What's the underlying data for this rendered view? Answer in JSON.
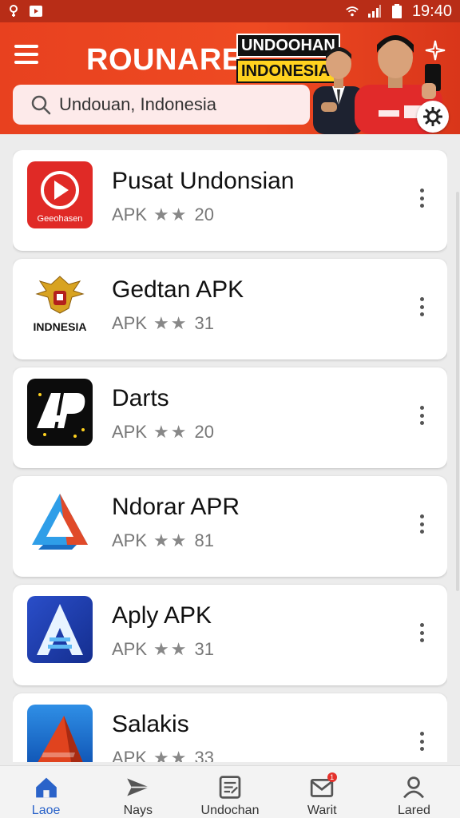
{
  "status_bar": {
    "time": "19:40",
    "icons": [
      "notification-icon",
      "youtube-icon",
      "wifi-icon",
      "signal-icon",
      "battery-icon"
    ]
  },
  "header": {
    "brand": "ROUNARE",
    "promo_line1": "UNDOOHAN",
    "promo_line2": "INDONESIA!",
    "search_text": "Undouan, Indonesia",
    "colors": {
      "primary": "#e8411f",
      "status_bar": "#b82d17",
      "promo_yellow": "#ffd21f"
    }
  },
  "apps": [
    {
      "name": "Pusat Undonsian",
      "type": "APK",
      "stars": "★★",
      "count": "20",
      "icon": "play-icon",
      "icon_caption": "Geeohasen"
    },
    {
      "name": "Gedtan APK",
      "type": "APK",
      "stars": "★★",
      "count": "31",
      "icon": "garuda-emblem-icon",
      "icon_caption": "INDNESIA"
    },
    {
      "name": "Darts",
      "type": "APK",
      "stars": "★★",
      "count": "20",
      "icon": "ap-logo-icon"
    },
    {
      "name": "Ndorar APR",
      "type": "APK",
      "stars": "★★",
      "count": "81",
      "icon": "prism-triangle-icon"
    },
    {
      "name": "Aply APK",
      "type": "APK",
      "stars": "★★",
      "count": "31",
      "icon": "a-letter-icon"
    },
    {
      "name": "Salakis",
      "type": "APK",
      "stars": "★★",
      "count": "33",
      "icon": "red-arrow-icon"
    }
  ],
  "bottom_nav": [
    {
      "label": "Laoe",
      "icon": "home-icon",
      "active": true
    },
    {
      "label": "Nays",
      "icon": "send-icon",
      "active": false
    },
    {
      "label": "Undochan",
      "icon": "document-icon",
      "active": false
    },
    {
      "label": "Warit",
      "icon": "mail-icon",
      "active": false,
      "badge": "1"
    },
    {
      "label": "Lared",
      "icon": "profile-icon",
      "active": false
    }
  ]
}
